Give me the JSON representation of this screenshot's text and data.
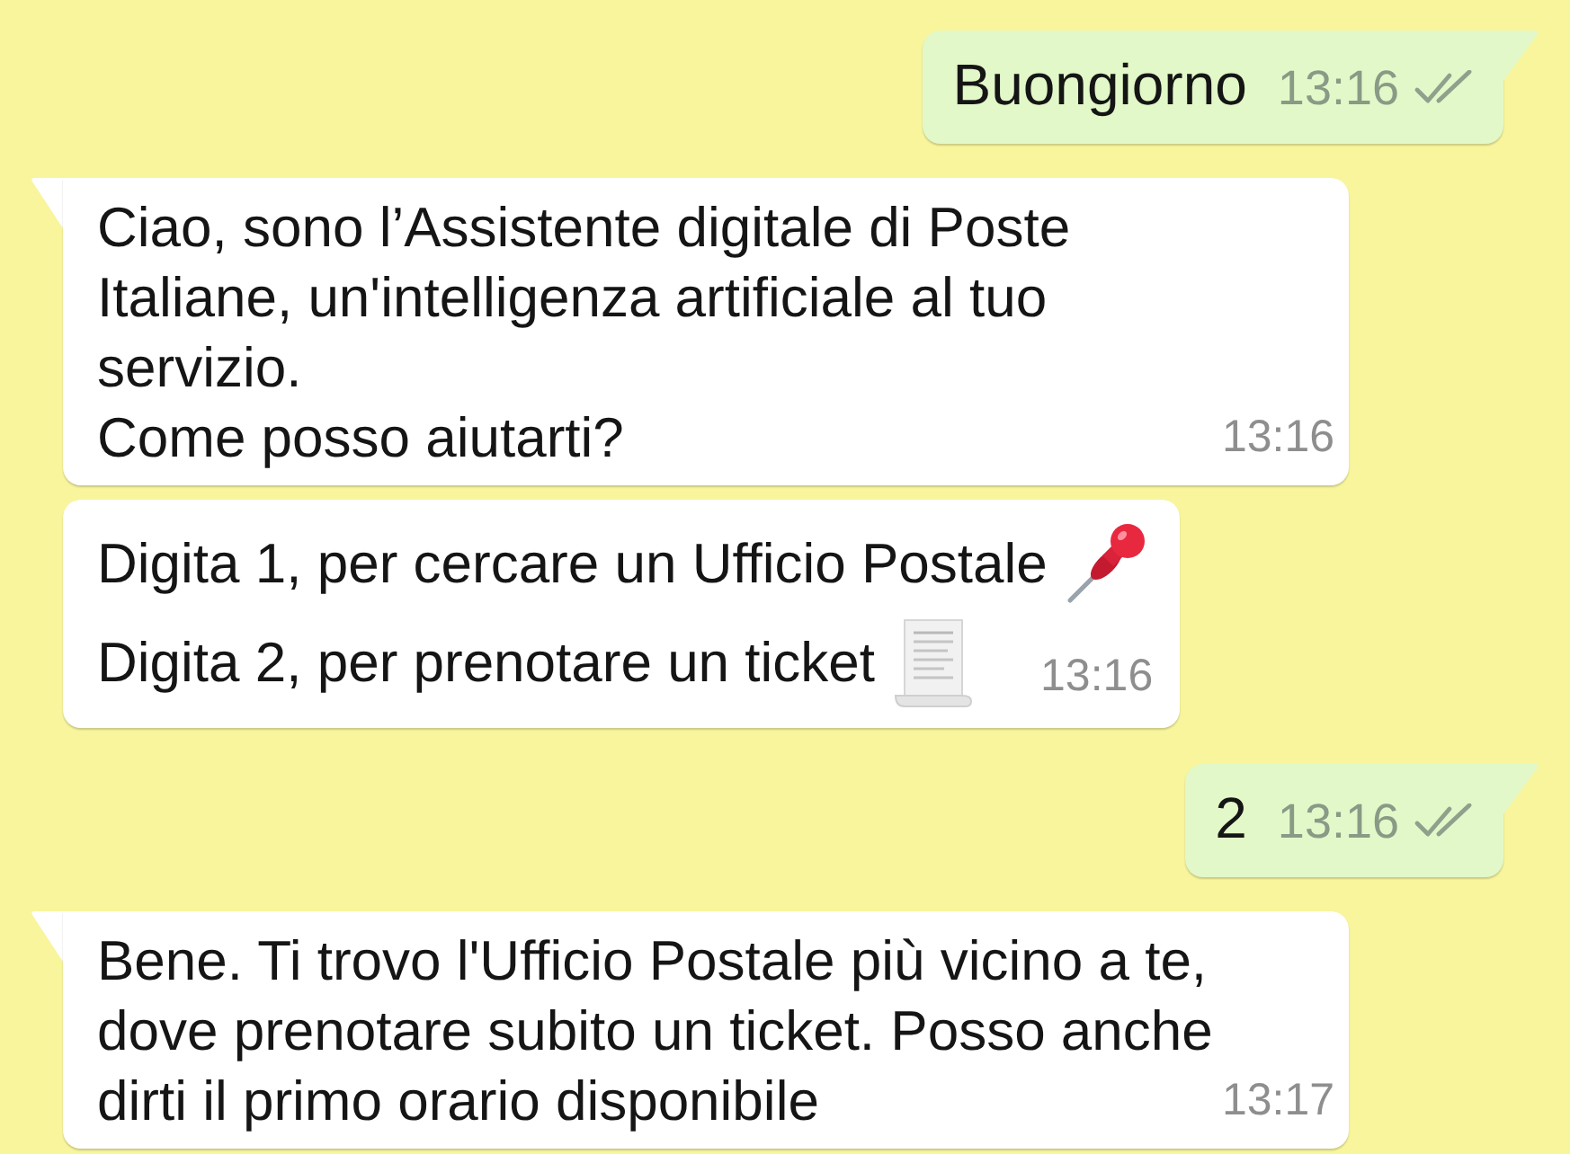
{
  "messages": [
    {
      "kind": "outgoing",
      "tail": true,
      "text": "Buongiorno",
      "time": "13:16",
      "read": false
    },
    {
      "kind": "incoming",
      "tail": true,
      "paragraphs": [
        [
          "Ciao, sono l’Assistente digitale di Poste",
          "Italiane, un'intelligenza artificiale al tuo",
          "servizio."
        ],
        [
          "Come posso aiutarti?"
        ]
      ],
      "time": "13:16"
    },
    {
      "kind": "menu",
      "tail": false,
      "options": [
        {
          "kind": "pin",
          "text": "Digita 1, per cercare un Ufficio Postale"
        },
        {
          "kind": "document",
          "text": "Digita 2, per prenotare un ticket"
        }
      ],
      "time": "13:16"
    },
    {
      "kind": "outgoing",
      "tail": true,
      "text": "2",
      "time": "13:16",
      "read": false
    },
    {
      "kind": "incoming",
      "tail": true,
      "paragraphs": [
        [
          "Bene. Ti trovo l'Ufficio Postale più vicino a te,",
          "dove prenotare subito un ticket. Posso anche",
          "dirti il primo orario disponibile"
        ]
      ],
      "time": "13:17"
    }
  ]
}
